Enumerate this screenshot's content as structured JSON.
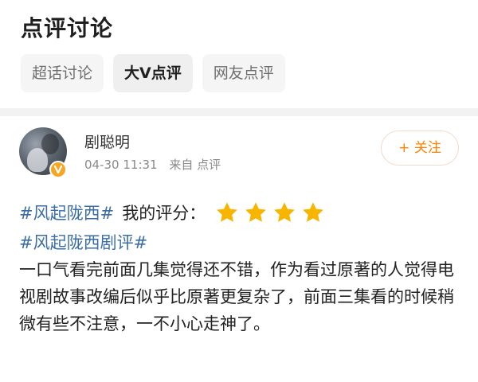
{
  "header": {
    "title": "点评讨论",
    "tabs": [
      {
        "label": "超话讨论",
        "active": false
      },
      {
        "label": "大V点评",
        "active": true
      },
      {
        "label": "网友点评",
        "active": false
      }
    ]
  },
  "post": {
    "username": "剧聪明",
    "verified": true,
    "date": "04-30 11:31",
    "source": "来自 点评",
    "follow_label": "+ 关注",
    "hashtag_main": "#风起陇西#",
    "rating_label": "我的评分：",
    "rating": {
      "value": 4,
      "max": 4
    },
    "hashtag_review": "#风起陇西剧评#",
    "content": "一口气看完前面几集觉得还不错，作为看过原著的人觉得电视剧故事改编后似乎比原著更复杂了，前面三集看的时候稍微有些不注意，一不小心走神了。"
  },
  "colors": {
    "accent_orange": "#ff8200",
    "star": "#f7b500",
    "hashtag": "#3b6ea8",
    "verified_badge": "#f5a623"
  }
}
